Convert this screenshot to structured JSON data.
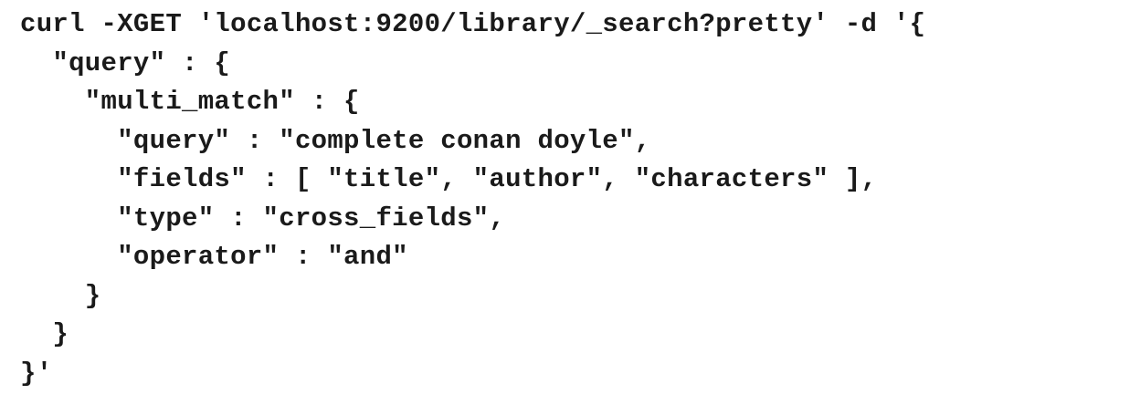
{
  "code": {
    "lines": [
      "curl -XGET 'localhost:9200/library/_search?pretty' -d '{",
      "  \"query\" : {",
      "    \"multi_match\" : {",
      "      \"query\" : \"complete conan doyle\",",
      "      \"fields\" : [ \"title\", \"author\", \"characters\" ],",
      "      \"type\" : \"cross_fields\",",
      "      \"operator\" : \"and\"",
      "    }",
      "  }",
      "}'"
    ]
  }
}
